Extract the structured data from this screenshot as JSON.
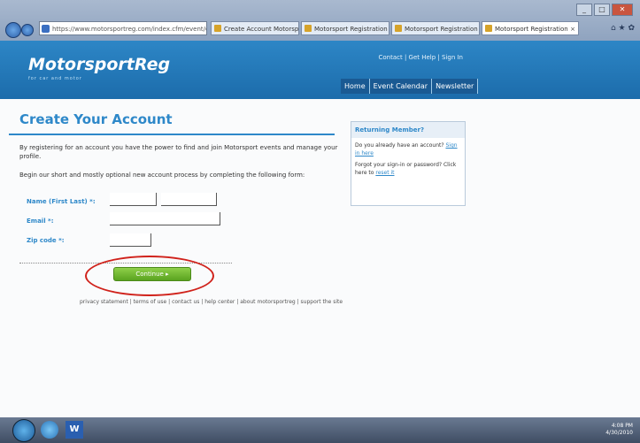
{
  "browser": {
    "address": "https://www.motorsportreg.com/index.cfm/event/create",
    "tabs": [
      "Create Account Motorsport...",
      "Motorsport Registration",
      "Motorsport Registration",
      "Motorsport Registration"
    ],
    "tools_label": "⌂ ★ ✿"
  },
  "site": {
    "logo": "MotorsportReg",
    "tagline": "for car and motor",
    "toplinks": "Contact | Get Help | Sign In",
    "nav": [
      "Home",
      "Event Calendar",
      "Newsletter"
    ]
  },
  "page": {
    "title": "Create Your Account",
    "intro": "By registering for an account you have the power to find and join Motorsport events and manage your profile.",
    "intro2": "Begin our short and mostly optional new account process by completing the following form:",
    "labels": {
      "name": "Name (First Last) *:",
      "email": "Email *:",
      "zip": "Zip code *:"
    },
    "continue": "Continue",
    "footer_links": "privacy statement | terms of use | contact us | help center | about motorsportreg | support the site"
  },
  "sidebar": {
    "heading": "Returning Member?",
    "p1": "Do you already have an account? ",
    "p1_link": "Sign in here",
    "p2": "Forgot your sign-in or password? Click here to ",
    "p2_link": "reset it"
  },
  "tray": {
    "time": "4:08 PM",
    "date": "4/30/2010"
  }
}
